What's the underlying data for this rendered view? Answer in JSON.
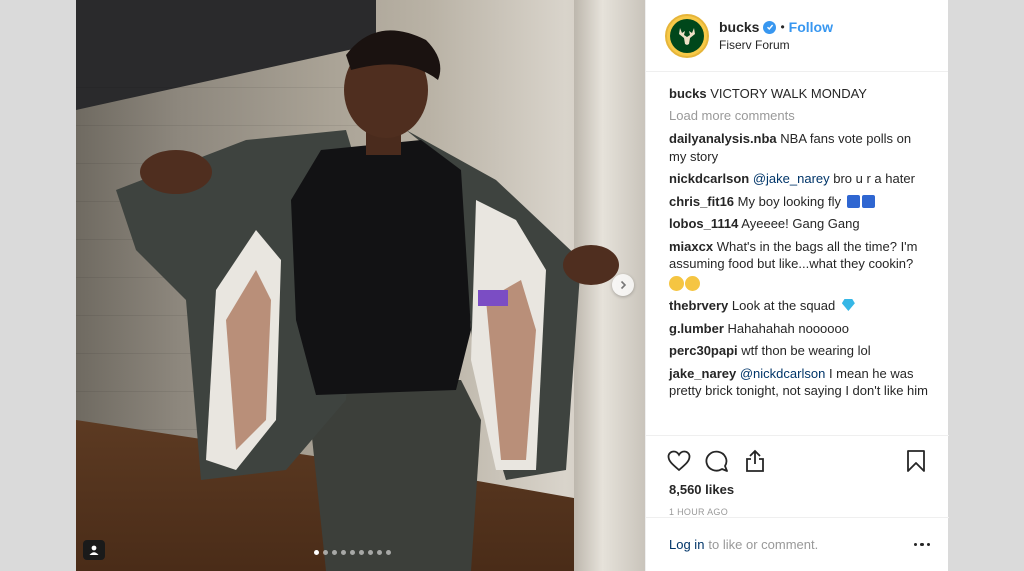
{
  "post": {
    "header": {
      "username": "bucks",
      "separator": "•",
      "follow_label": "Follow",
      "location": "Fiserv Forum",
      "verified_icon": "verified-badge-icon"
    },
    "caption": {
      "username": "bucks",
      "text": "VICTORY WALK MONDAY"
    },
    "load_more_label": "Load more comments",
    "comments": [
      {
        "user": "dailyanalysis.nba",
        "text": "NBA fans vote polls on my story"
      },
      {
        "user": "nickdcarlson",
        "mention": "@jake_narey",
        "text": "bro u r a hater"
      },
      {
        "user": "chris_fit16",
        "text": "My boy looking fly"
      },
      {
        "user": "lobos_1114",
        "text": "Ayeeee! Gang Gang"
      },
      {
        "user": "miaxcx",
        "text": "What's in the bags all the time? I'm assuming food but like...what they cookin?"
      },
      {
        "user": "thebrvery",
        "text": "Look at the squad"
      },
      {
        "user": "g.lumber",
        "text": "Hahahahah noooooo"
      },
      {
        "user": "perc30papi",
        "text": "wtf thon be wearing lol"
      },
      {
        "user": "jake_narey",
        "mention": "@nickdcarlson",
        "text": "I mean he was pretty brick tonight, not saying I don't like him"
      }
    ],
    "likes": "8,560 likes",
    "time": "1 HOUR AGO",
    "login_link": "Log in",
    "login_text": "to like or comment.",
    "carousel": {
      "total": 9,
      "active_index": 0
    },
    "colors": {
      "accent": "#3897f0",
      "link": "#003569",
      "brand_green": "#00471b",
      "brand_cream": "#f7c948"
    }
  }
}
